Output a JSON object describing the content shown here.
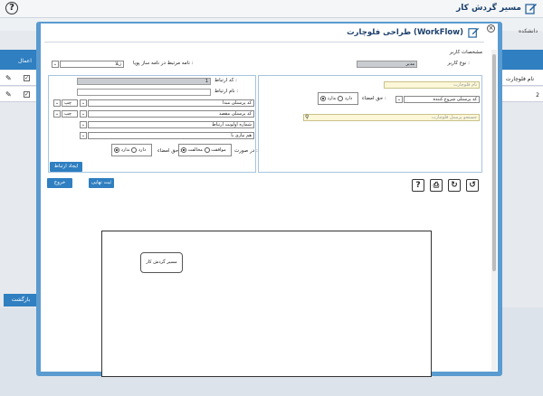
{
  "app": {
    "title": "مسیر گردش کار",
    "help": "?"
  },
  "background": {
    "label": "دانشکده",
    "row1": {
      "name": "نام فلوچارت",
      "action_col": "اعمال"
    },
    "row2": {
      "index": "2"
    },
    "back_button": "بازگشت"
  },
  "modal": {
    "title": "طراحی فلوچارت (WorkFlow)",
    "close": "×",
    "section_label": "مشخصات کاربر",
    "user_type_label": "نوع کاربر :",
    "user_type_value": "مدیر",
    "letter_name_label": "نامه مرتبط در نامه ساز پویا :",
    "letter_name_value": "ژیلا",
    "flow_name_placeholder": "نام فلوچارت",
    "start_user_value": "کد پرسنلی شروع کننده",
    "sign_right_label": "حق امضاء :",
    "has": "دارد",
    "has_not": "ندارد",
    "search_placeholder": "جستجو پرسنل فلوچارت",
    "rel_code_label": "کد ارتباط :",
    "rel_code_value": "1",
    "rel_name_label": "نام ارتباط :",
    "origin_code_value": "کد پرسنلی مبدا",
    "dest_code_value": "کد پرسنلی مقصد",
    "priority_value": "شماره اولویت ارتباط",
    "parallel_value": "هم نیازی با",
    "left_value": "چپ",
    "in_case_label": "در صورت :",
    "agree": "موافقت",
    "disagree": "مخالفت",
    "create_rel_button": "ایجاد ارتباط",
    "final_save_button": "ثبت نهایی",
    "exit_button": "خروج",
    "node_label": "مسیر گردش کار"
  }
}
